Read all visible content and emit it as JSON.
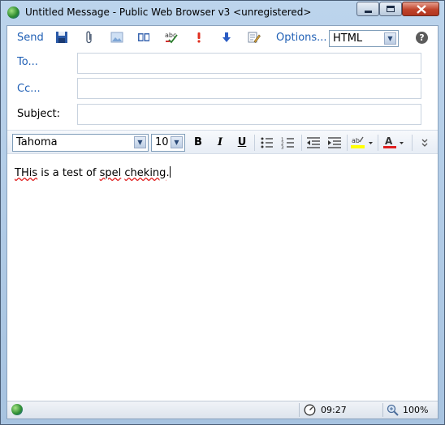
{
  "window": {
    "title": "Untitled Message - Public Web Browser v3 <unregistered>"
  },
  "toolbar": {
    "send_label": "Send",
    "options_label": "Options...",
    "format_select": "HTML",
    "icons": [
      "save-icon",
      "attach-icon",
      "insert-image-icon",
      "address-book-icon",
      "spell-check-icon",
      "high-importance-icon",
      "low-importance-icon",
      "edit-icon",
      "help-icon"
    ]
  },
  "fields": {
    "to_label": "To...",
    "cc_label": "Cc...",
    "subject_label": "Subject:",
    "to_value": "",
    "cc_value": "",
    "subject_value": ""
  },
  "format": {
    "font": "Tahoma",
    "size": "10",
    "bold": "B",
    "italic": "I",
    "underline": "U"
  },
  "body": {
    "text_part1": "THis",
    "text_part2": " is a test of ",
    "text_part3": "spel",
    "text_part4": " ",
    "text_part5": "cheking",
    "text_part6": "."
  },
  "status": {
    "time": "09:27",
    "zoom": "100%"
  },
  "colors": {
    "link": "#1f5fb5",
    "highlight": "#ffff00",
    "font_color": "#e02020",
    "spellcheck_underline": "#e02020"
  }
}
